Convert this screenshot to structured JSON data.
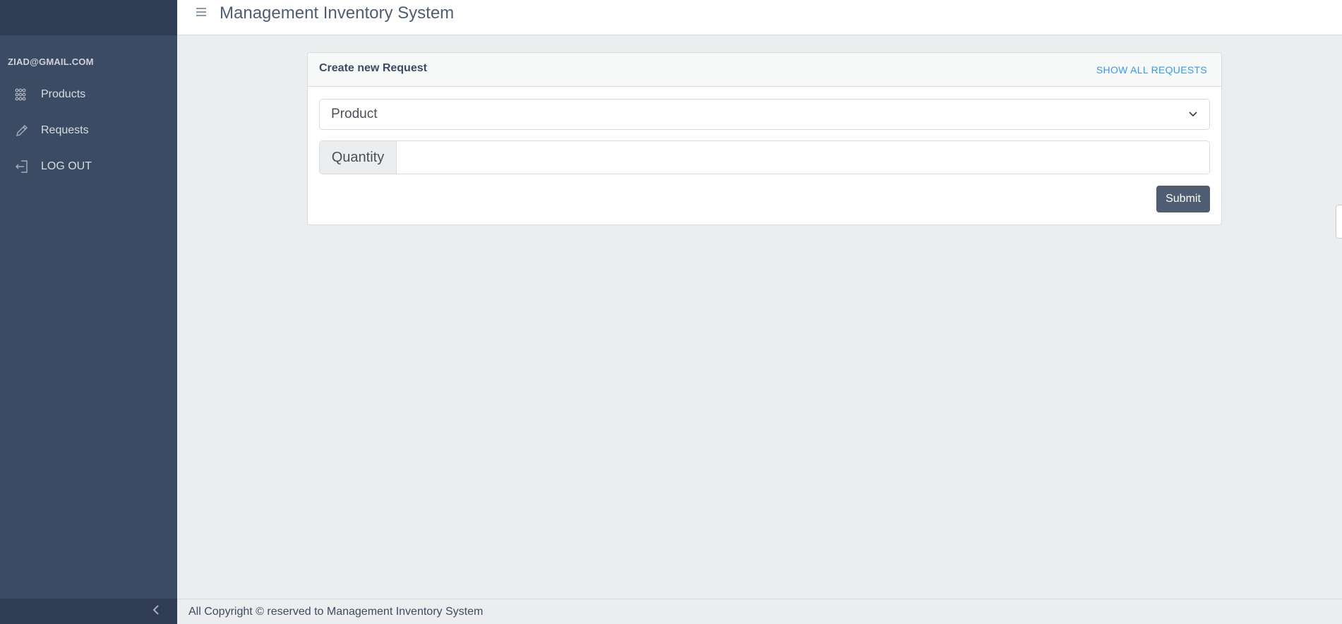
{
  "sidebar": {
    "user_email": "ZIAD@GMAIL.COM",
    "items": [
      {
        "label": "Products",
        "icon": "grid-icon"
      },
      {
        "label": "Requests",
        "icon": "pencil-icon"
      },
      {
        "label": "LOG OUT",
        "icon": "logout-icon"
      }
    ]
  },
  "header": {
    "title": "Management Inventory System"
  },
  "card": {
    "title": "Create new Request",
    "link": "SHOW ALL REQUESTS",
    "product_select": "Product",
    "quantity_label": "Quantity",
    "quantity_value": "",
    "submit_label": "Submit"
  },
  "footer": {
    "text": "All Copyright © reserved to Management Inventory System"
  },
  "colors": {
    "sidebar": "#3c4b64",
    "sidebar_dark": "#303c54",
    "background": "#ebedef",
    "link": "#3399ff",
    "button": "#4f5d73"
  }
}
